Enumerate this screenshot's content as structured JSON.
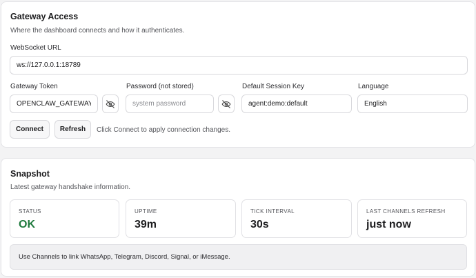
{
  "gateway_access": {
    "title": "Gateway Access",
    "subtitle": "Where the dashboard connects and how it authenticates.",
    "websocket_url": {
      "label": "WebSocket URL",
      "value": "ws://127.0.0.1:18789"
    },
    "gateway_token": {
      "label": "Gateway Token",
      "value": "OPENCLAW_GATEWAY",
      "toggle_icon": "eye-off-icon"
    },
    "password": {
      "label": "Password (not stored)",
      "placeholder": "system password",
      "toggle_icon": "eye-off-icon"
    },
    "session_key": {
      "label": "Default Session Key",
      "value": "agent:demo:default"
    },
    "language": {
      "label": "Language",
      "value": "English"
    },
    "connect_label": "Connect",
    "refresh_label": "Refresh",
    "hint": "Click Connect to apply connection changes."
  },
  "snapshot": {
    "title": "Snapshot",
    "subtitle": "Latest gateway handshake information.",
    "stats": [
      {
        "label": "STATUS",
        "value": "OK"
      },
      {
        "label": "UPTIME",
        "value": "39m"
      },
      {
        "label": "TICK INTERVAL",
        "value": "30s"
      },
      {
        "label": "LAST CHANNELS REFRESH",
        "value": "just now"
      }
    ],
    "note": "Use Channels to link WhatsApp, Telegram, Discord, Signal, or iMessage."
  },
  "colors": {
    "status_ok": "#1f7a3d",
    "card_bg": "#ffffff",
    "page_bg": "#f3f3f4"
  }
}
